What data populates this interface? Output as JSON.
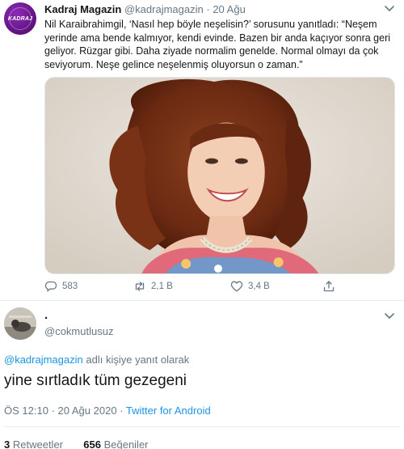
{
  "tweet": {
    "author_name": "Kadraj Magazin",
    "author_handle": "@kadrajmagazin",
    "separator": "·",
    "date": "20 Ağu",
    "avatar_text": "KADRAJ",
    "text": "Nil Karaibrahimgil, ‘Nasıl hep böyle neşelisin?’ sorusunu yanıtladı: “Neşem yerinde ama bende kalmıyor, kendi evinde. Bazen bir anda kaçıyor sonra geri geliyor. Rüzgar gibi. Daha ziyade normalim genelde. Normal olmayı da çok seviyorum. Neşe gelince neşelenmiş oluyorsun o zaman.”",
    "replies": "583",
    "retweets": "2,1 B",
    "likes": "3,4 B"
  },
  "reply": {
    "author_name": ".",
    "author_handle": "@cokmutlusuz",
    "replying_to_handle": "@kadrajmagazin",
    "replying_suffix": "adlı kişiye yanıt olarak",
    "text": "yine sırtladık tüm gezegeni",
    "time": "ÖS 12:10",
    "separator": "·",
    "date": "20 Ağu 2020",
    "source": "Twitter for Android",
    "retweet_count": "3",
    "retweet_label": "Retweetler",
    "like_count": "656",
    "like_label": "Beğeniler"
  },
  "colors": {
    "link": "#1b95e0",
    "muted": "#657786",
    "text": "#14171a",
    "avatar_brand": "#6a1b9a"
  },
  "icons": [
    "chevron-down-icon",
    "reply-icon",
    "retweet-icon",
    "like-icon",
    "share-icon"
  ]
}
